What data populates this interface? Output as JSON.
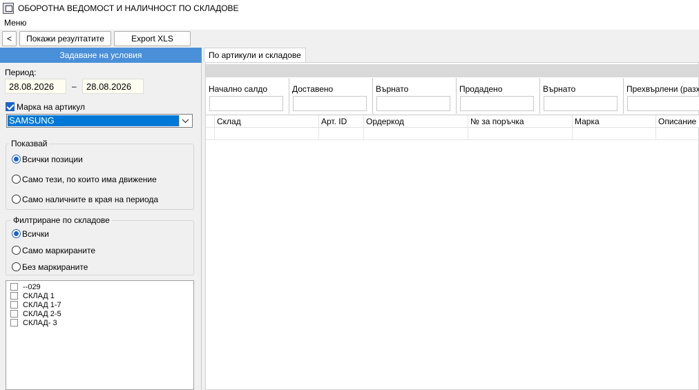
{
  "window": {
    "title": "ОБОРОТНА ВЕДОМОСТ И НАЛИЧНОСТ ПО СКЛАДОВЕ"
  },
  "menu": {
    "label": "Меню"
  },
  "toolbar": {
    "back_label": "<",
    "show_results_label": "Покажи резултатите",
    "export_label": "Export XLS"
  },
  "left_panel": {
    "header": "Задаване на условия",
    "period_label": "Период:",
    "date_from": "28.08.2026",
    "date_separator": "–",
    "date_to": "28.08.2026",
    "brand_checkbox_label": "Марка на артикул",
    "brand_checked": true,
    "brand_selected": "SAMSUNG",
    "show_group": {
      "title": "Показвай",
      "options": [
        "Всички позиции",
        "Само тези, по които има движение",
        "Само наличните в края на периода"
      ],
      "selected_index": 0
    },
    "filter_group": {
      "title": "Филтриране по складове",
      "options": [
        "Всички",
        "Само маркираните",
        "Без маркираните"
      ],
      "selected_index": 0
    },
    "warehouses": [
      "--029",
      "СКЛАД 1",
      "СКЛАД 1-7",
      "СКЛАД 2-5",
      "СКЛАД- 3"
    ]
  },
  "right_panel": {
    "tab_label": "По артикули и складове",
    "summary_labels": [
      "Начално салдо",
      "Доставено",
      "Върнато",
      "Продадено",
      "Върнато",
      "Прехвърлени (разхо"
    ],
    "grid_columns": [
      "Склад",
      "Арт. ID",
      "Ордеркод",
      "№ за поръчка",
      "Марка",
      "Описание"
    ]
  },
  "colors": {
    "header_blue": "#4a90d9",
    "selection_blue": "#0078d7",
    "date_field_bg": "#fffdf0"
  }
}
